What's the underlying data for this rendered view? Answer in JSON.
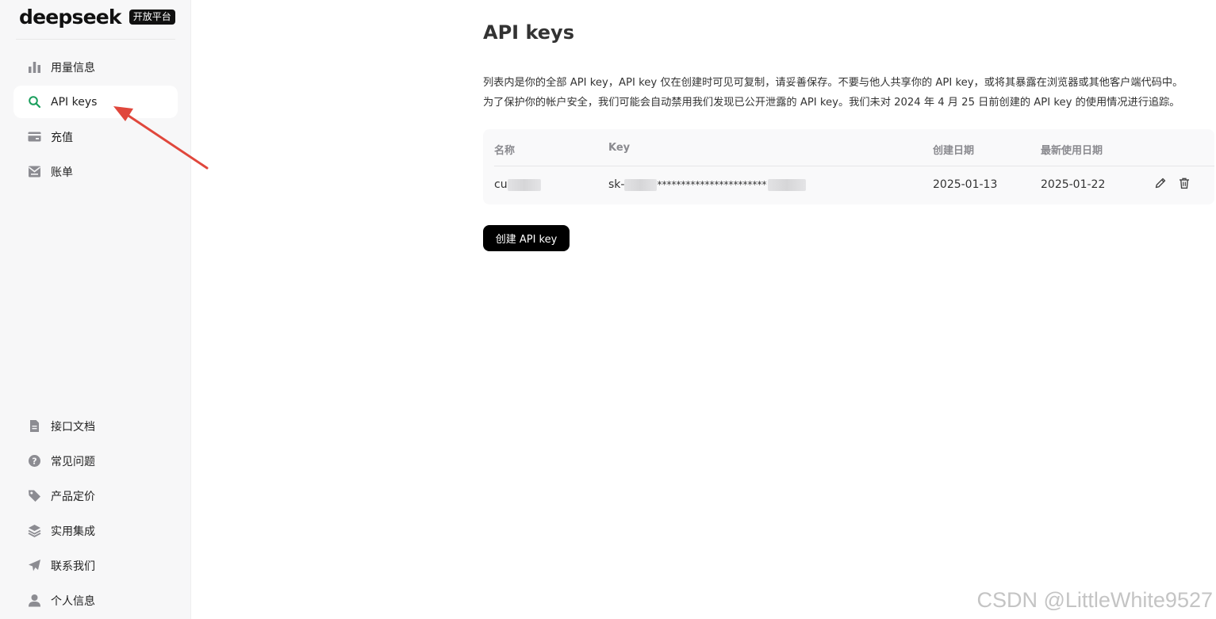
{
  "brand": {
    "logo_text": "deepseek",
    "badge": "开放平台"
  },
  "sidebar": {
    "top_items": [
      {
        "label": "用量信息",
        "icon": "bar-chart-icon"
      },
      {
        "label": "API keys",
        "icon": "search-key-icon",
        "active": true
      },
      {
        "label": "充值",
        "icon": "wallet-icon"
      },
      {
        "label": "账单",
        "icon": "bill-icon"
      }
    ],
    "bottom_items": [
      {
        "label": "接口文档",
        "icon": "document-icon"
      },
      {
        "label": "常见问题",
        "icon": "question-icon"
      },
      {
        "label": "产品定价",
        "icon": "price-tag-icon"
      },
      {
        "label": "实用集成",
        "icon": "layers-icon"
      },
      {
        "label": "联系我们",
        "icon": "paper-plane-icon"
      },
      {
        "label": "个人信息",
        "icon": "user-icon"
      }
    ]
  },
  "main": {
    "title": "API keys",
    "description_line1": "列表内是你的全部 API key，API key 仅在创建时可见可复制，请妥善保存。不要与他人共享你的 API key，或将其暴露在浏览器或其他客户端代码中。",
    "description_line2": "为了保护你的帐户安全，我们可能会自动禁用我们发现已公开泄露的 API key。我们未对 2024 年 4 月 25 日前创建的 API key 的使用情况进行追踪。",
    "table": {
      "headers": {
        "name": "名称",
        "key": "Key",
        "created": "创建日期",
        "last_used": "最新使用日期"
      },
      "rows": [
        {
          "name_prefix": "cu",
          "key_prefix": "sk-",
          "key_mask": "*******************",
          "key_mask2": "****",
          "created": "2025-01-13",
          "last_used": "2025-01-22"
        }
      ]
    },
    "create_button": "创建 API key"
  },
  "colors": {
    "accent_green": "#1a9e5c",
    "annotation_red": "#e0473c",
    "button_bg": "#000000"
  },
  "watermark": "CSDN @LittleWhite9527"
}
